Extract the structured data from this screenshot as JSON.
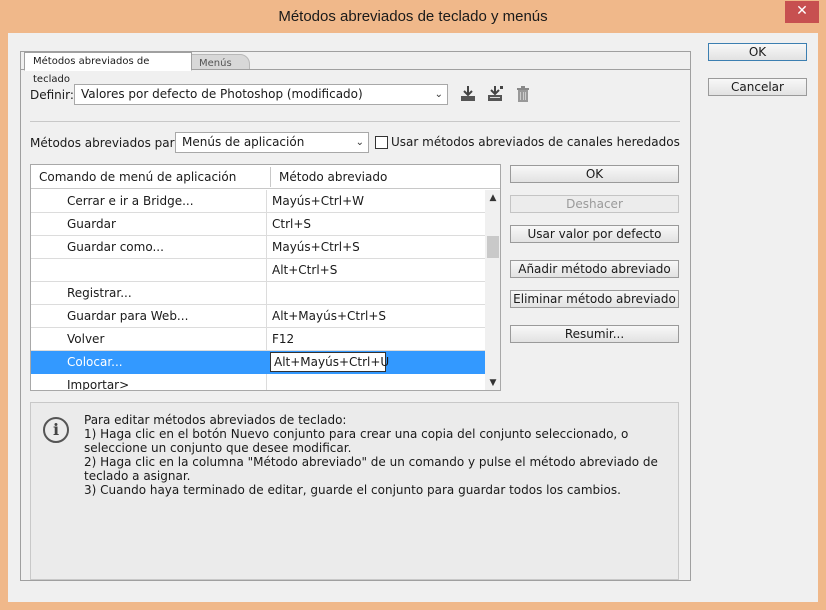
{
  "window": {
    "title": "Métodos abreviados de teclado y menús",
    "close_glyph": "✕"
  },
  "tabs": [
    {
      "label": "Métodos abreviados de teclado",
      "active": true
    },
    {
      "label": "Menús",
      "active": false
    }
  ],
  "set": {
    "label": "Definir:",
    "value": "Valores por defecto de Photoshop (modificado)",
    "icons": [
      "save-set-icon",
      "save-as-set-icon",
      "delete-set-icon"
    ]
  },
  "shortcuts_for": {
    "label": "Métodos abreviados para:",
    "value": "Menús de aplicación",
    "checkbox_label": "Usar métodos abreviados de canales heredados",
    "checked": false
  },
  "table": {
    "columns": [
      "Comando de menú de aplicación",
      "Método abreviado"
    ],
    "rows": [
      {
        "command": "Cerrar e ir a Bridge...",
        "shortcut": "Mayús+Ctrl+W"
      },
      {
        "command": "Guardar",
        "shortcut": "Ctrl+S"
      },
      {
        "command": "Guardar como...",
        "shortcut": "Mayús+Ctrl+S"
      },
      {
        "command": "",
        "shortcut": "Alt+Ctrl+S"
      },
      {
        "command": "Registrar...",
        "shortcut": ""
      },
      {
        "command": "Guardar para Web...",
        "shortcut": "Alt+Mayús+Ctrl+S"
      },
      {
        "command": "Volver",
        "shortcut": "F12"
      },
      {
        "command": "Colocar...",
        "shortcut": "Alt+Mayús+Ctrl+U",
        "selected": true
      },
      {
        "command": "Importar>",
        "shortcut": ""
      }
    ]
  },
  "side_buttons": {
    "ok": "OK",
    "undo": "Deshacer",
    "use_default": "Usar valor por defecto",
    "add": "Añadir método abreviado",
    "delete": "Eliminar método abreviado",
    "summarize": "Resumir..."
  },
  "dialog_buttons": {
    "ok": "OK",
    "cancel": "Cancelar"
  },
  "info": {
    "text": "Para editar métodos abreviados de teclado:\n1) Haga clic en el botón Nuevo conjunto para crear una copia del conjunto seleccionado, o seleccione un conjunto que desee modificar.\n2) Haga clic en la columna \"Método abreviado\" de un comando y pulse el método abreviado de teclado a asignar.\n3) Cuando haya terminado de editar, guarde el conjunto para guardar todos los cambios."
  },
  "colors": {
    "title_bar": "#f0b88a",
    "selection": "#3399ff",
    "close_button": "#c75050"
  }
}
